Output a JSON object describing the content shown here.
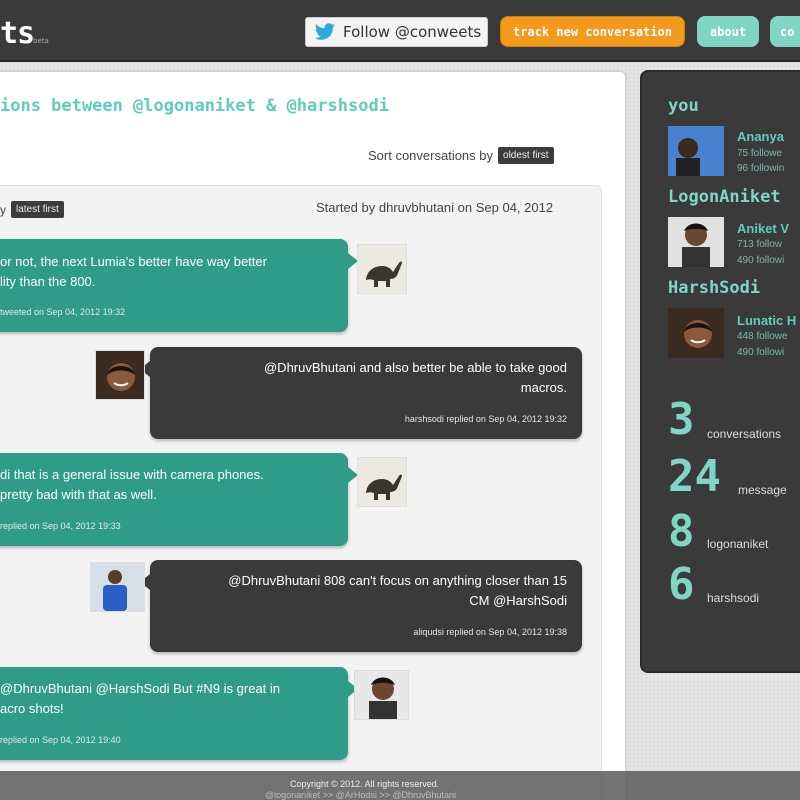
{
  "header": {
    "logo_text": "ts",
    "logo_beta": "beta",
    "follow_label": "Follow @conweets",
    "track_label": "track new conversation",
    "about_label": "about",
    "other_label": "co"
  },
  "main": {
    "title": "ions between @logonaniket & @harshsodi",
    "sort_label": "Sort conversations by",
    "sort_value": "oldest first",
    "conv_sort_prefix": "y",
    "conv_sort_value": "latest first",
    "started_by": "Started by dhruvbhutani on Sep 04, 2012"
  },
  "messages": [
    {
      "side": "teal",
      "text_lines": [
        "or not, the next Lumia's better have way better",
        "lity than the 800."
      ],
      "meta": "tweeted on Sep 04, 2012 19:32",
      "avatar": "elephant-avatar-icon"
    },
    {
      "side": "dark",
      "text_lines": [
        "@DhruvBhutani and also better be able to take good",
        "macros."
      ],
      "meta": "harshsodi replied on Sep 04, 2012 19:32",
      "avatar": "harshsodi-avatar-icon"
    },
    {
      "side": "teal",
      "text_lines": [
        "di that is a general issue with camera phones.",
        "pretty bad with that as well."
      ],
      "meta": "replied on Sep 04, 2012 19:33",
      "avatar": "elephant-avatar-icon"
    },
    {
      "side": "dark",
      "text_lines": [
        "@DhruvBhutani 808 can't focus on anything closer than 15",
        "CM @HarshSodi"
      ],
      "meta": "aliqudsi replied on Sep 04, 2012 19:38",
      "avatar": "aliqudsi-avatar-icon"
    },
    {
      "side": "teal",
      "text_lines": [
        "@DhruvBhutani @HarshSodi But #N9 is great in",
        "acro shots!"
      ],
      "meta": "replied on Sep 04, 2012 19:40",
      "avatar": "logonaniket-avatar-icon"
    }
  ],
  "sidebar": {
    "you_heading": "you",
    "you_name": "Ananya",
    "you_followers": "75 followe",
    "you_following": "96 followin",
    "user1_heading": "LogonAniket",
    "user1_name": "Aniket V",
    "user1_followers": "713 follow",
    "user1_following": "490 followi",
    "user2_heading": "HarshSodi",
    "user2_name": "Lunatic H",
    "user2_followers": "448 followe",
    "user2_following": "490 followi",
    "stats": [
      {
        "value": "3",
        "label": "conversations"
      },
      {
        "value": "24",
        "label": "message"
      },
      {
        "value": "8",
        "label": "logonaniket"
      },
      {
        "value": "6",
        "label": "harshsodi"
      }
    ]
  },
  "footer": {
    "copyright": "Copyright © 2012. All rights reserved.",
    "nav": "@logonaniket >> @ArHodsi >> @DhruvBhutani"
  },
  "colors": {
    "teal": "#2f9c89",
    "accent": "#7fd6c6",
    "orange": "#f39a1c",
    "dark": "#3a3a3a"
  }
}
